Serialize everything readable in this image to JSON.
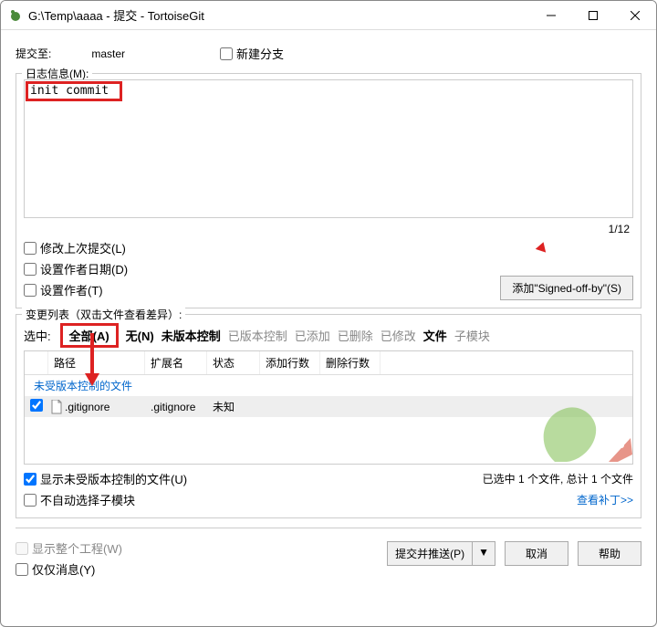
{
  "window": {
    "title": "G:\\Temp\\aaaa - 提交 - TortoiseGit"
  },
  "commit_to": {
    "label": "提交至:",
    "branch": "master",
    "new_branch_label": "新建分支"
  },
  "log": {
    "legend": "日志信息(M):",
    "message": "init commit",
    "counter": "1/12",
    "amend_label": "修改上次提交(L)",
    "set_author_date_label": "设置作者日期(D)",
    "set_author_label": "设置作者(T)",
    "signed_off_label": "添加\"Signed-off-by\"(S)"
  },
  "changes": {
    "legend": "变更列表（双击文件查看差异）:",
    "select_label": "选中:",
    "filters": {
      "all": "全部(A)",
      "none": "无(N)",
      "unversioned": "未版本控制",
      "versioned": "已版本控制",
      "added": "已添加",
      "deleted": "已删除",
      "modified": "已修改",
      "files": "文件",
      "submodules": "子模块"
    },
    "columns": {
      "path": "路径",
      "ext": "扩展名",
      "status": "状态",
      "add_lines": "添加行数",
      "del_lines": "删除行数"
    },
    "group_label": "未受版本控制的文件",
    "rows": [
      {
        "checked": true,
        "path": ".gitignore",
        "ext": ".gitignore",
        "status": "未知",
        "add": "",
        "del": ""
      }
    ],
    "status": "已选中 1 个文件, 总计 1 个文件",
    "show_unversioned_label": "显示未受版本控制的文件(U)",
    "no_auto_submodule_label": "不自动选择子模块",
    "view_patch_label": "查看补丁>>"
  },
  "footer": {
    "show_whole_project_label": "显示整个工程(W)",
    "only_message_label": "仅仅消息(Y)",
    "commit_push_label": "提交并推送(P)",
    "cancel_label": "取消",
    "help_label": "帮助"
  }
}
